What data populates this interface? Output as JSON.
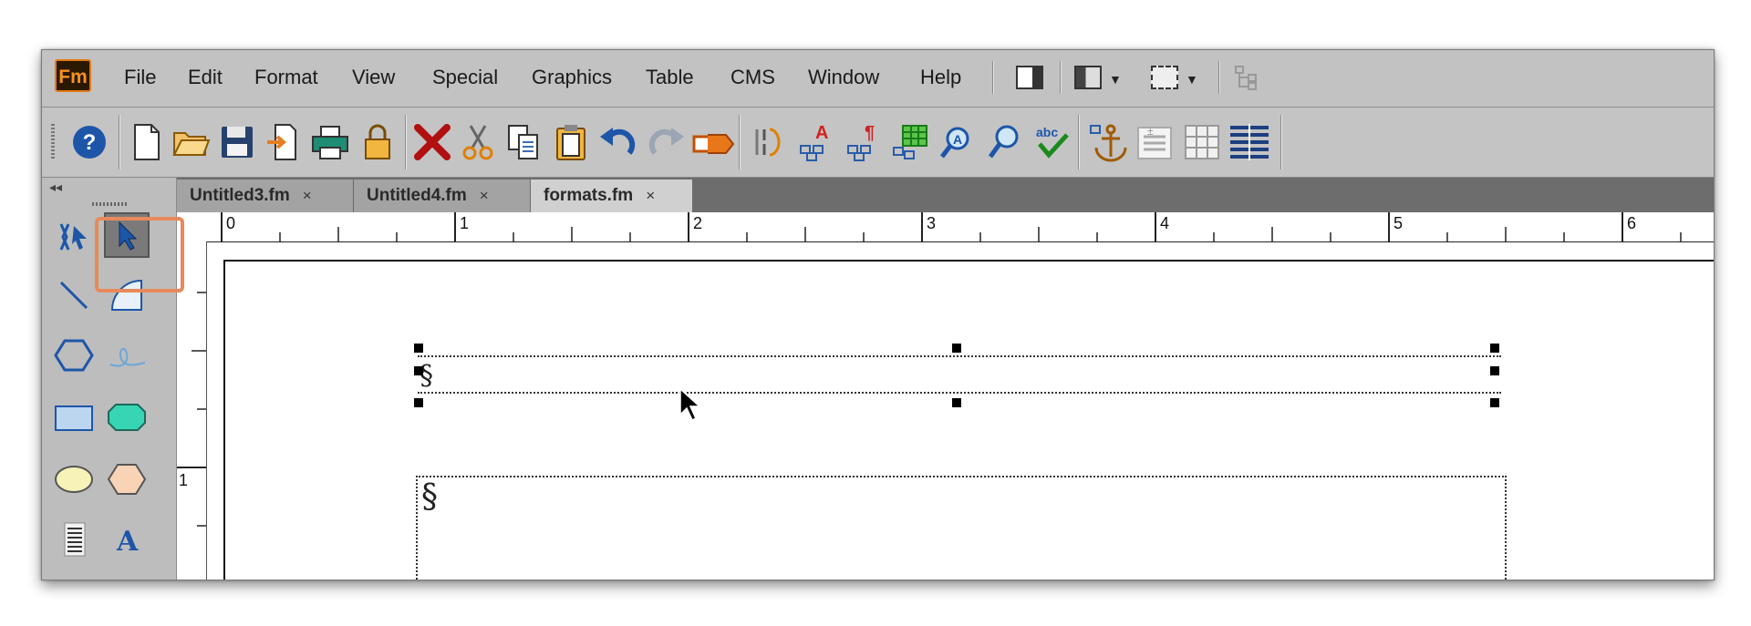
{
  "app": {
    "logo_text": "Fm",
    "accent": "#f7931e"
  },
  "menu": {
    "items": [
      "File",
      "Edit",
      "Format",
      "View",
      "Special",
      "Graphics",
      "Table",
      "CMS",
      "Window",
      "Help"
    ]
  },
  "menubar_icons": [
    "panel-layout-icon",
    "workspace-icon",
    "screen-mode-icon",
    "structure-view-icon"
  ],
  "toolbar": {
    "icons": [
      "help-icon",
      "new-document-icon",
      "open-folder-icon",
      "save-icon",
      "import-icon",
      "print-icon",
      "lock-icon",
      "delete-icon",
      "cut-icon",
      "copy-icon",
      "paste-icon",
      "undo-icon",
      "redo-icon",
      "redo-arrow-icon",
      "hyphenation-icon",
      "character-format-icon",
      "paragraph-format-icon",
      "table-insert-icon",
      "find-icon",
      "zoom-icon",
      "spell-check-icon",
      "anchor-icon",
      "insert-field-icon",
      "table-grid-icon",
      "text-flow-icon"
    ]
  },
  "tabs": [
    {
      "label": "Untitled3.fm",
      "close": "×"
    },
    {
      "label": "Untitled4.fm",
      "close": "×"
    },
    {
      "label": "formats.fm",
      "close": "×"
    }
  ],
  "ruler": {
    "horizontal_labels": [
      "0",
      "1",
      "2",
      "3",
      "4",
      "5",
      "6"
    ],
    "vertical_labels": [
      "1"
    ]
  },
  "tools": [
    "smart-select-tool",
    "object-select-tool",
    "line-tool",
    "arc-tool",
    "polygon-tool",
    "freehand-tool",
    "rectangle-tool",
    "rounded-rectangle-tool",
    "oval-tool",
    "polygon-filled-tool",
    "text-column-tool",
    "text-line-tool"
  ],
  "canvas": {
    "section_mark": "§"
  },
  "colors": {
    "highlight": "#e8895a",
    "tab_bg": "#6d6d6d"
  }
}
